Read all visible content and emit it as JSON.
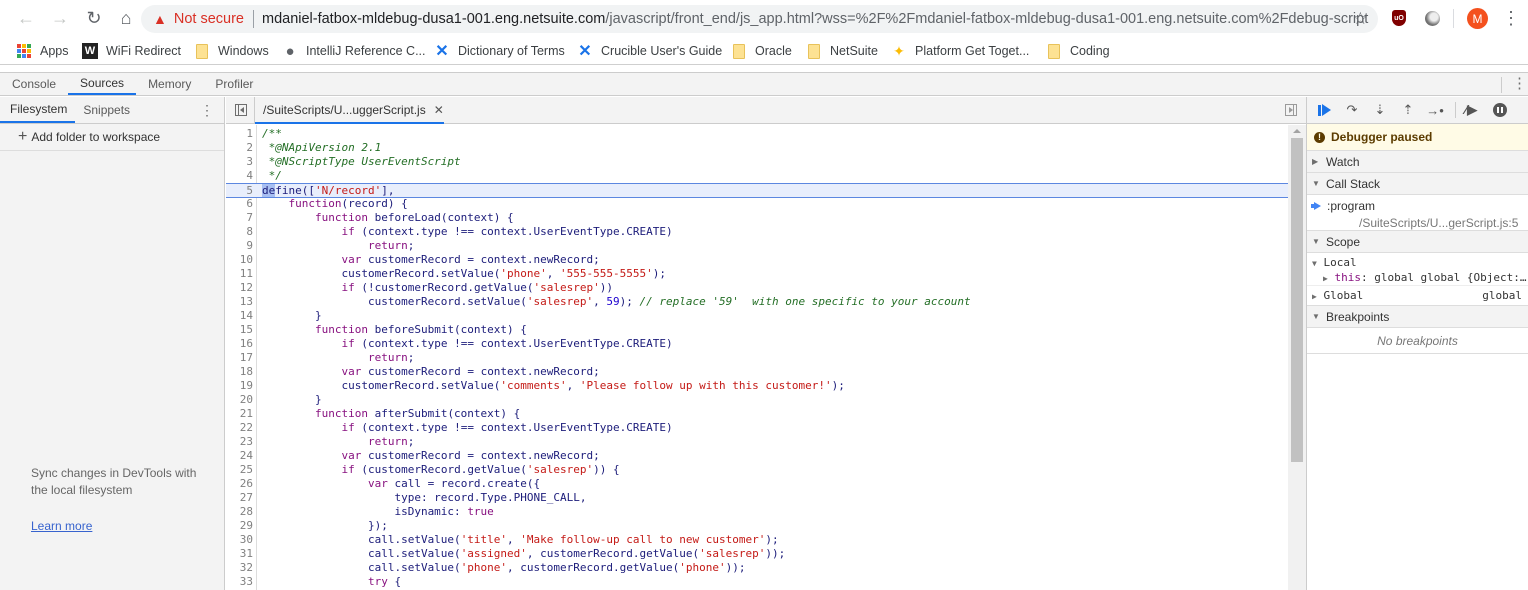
{
  "browser": {
    "security_label": "Not secure",
    "url_host": "mdaniel-fatbox-mldebug-dusa1-001.eng.netsuite.com",
    "url_path": "/javascript/front_end/js_app.html?wss=%2F%2Fmdaniel-fatbox-mldebug-dusa1-001.eng.netsuite.com%2Fdebug-script",
    "avatar_letter": "M",
    "ublock_label": "uO",
    "bookmarks": [
      {
        "label": "Apps",
        "icon": "apps-grid-icon"
      },
      {
        "label": "WiFi Redirect",
        "icon": "wifi-redirect-icon"
      },
      {
        "label": "Windows",
        "icon": "folder-icon"
      },
      {
        "label": "IntelliJ Reference C...",
        "icon": "globe-icon"
      },
      {
        "label": "Dictionary of Terms",
        "icon": "confluence-icon"
      },
      {
        "label": "Crucible User's Guide",
        "icon": "confluence-icon"
      },
      {
        "label": "Oracle",
        "icon": "folder-icon"
      },
      {
        "label": "NetSuite",
        "icon": "folder-icon"
      },
      {
        "label": "Platform Get Toget...",
        "icon": "pinwheel-icon"
      },
      {
        "label": "Coding",
        "icon": "folder-icon"
      }
    ]
  },
  "devtools": {
    "tabs": [
      {
        "label": "Console",
        "active": false
      },
      {
        "label": "Sources",
        "active": true
      },
      {
        "label": "Memory",
        "active": false
      },
      {
        "label": "Profiler",
        "active": false
      }
    ],
    "navigator": {
      "tabs": [
        {
          "label": "Filesystem",
          "active": true
        },
        {
          "label": "Snippets",
          "active": false
        }
      ],
      "add_folder_label": "Add folder to workspace",
      "sync_text": "Sync changes in DevTools with the local filesystem",
      "learn_more": "Learn more"
    },
    "editor": {
      "file_tab": "/SuiteScripts/U...uggerScript.js",
      "current_line": 5,
      "lines": [
        [
          {
            "t": "/**",
            "c": "comment"
          }
        ],
        [
          {
            "t": " *@NApiVersion 2.1",
            "c": "comment"
          }
        ],
        [
          {
            "t": " *@NScriptType UserEventScript",
            "c": "comment"
          }
        ],
        [
          {
            "t": " */",
            "c": "comment"
          }
        ],
        [
          {
            "t": "de",
            "c": "sel"
          },
          {
            "t": "fine",
            "c": "plainsel"
          },
          {
            "t": "([",
            "c": "plain"
          },
          {
            "t": "'N/record'",
            "c": "str"
          },
          {
            "t": "],",
            "c": "plain"
          }
        ],
        [
          {
            "t": "    ",
            "c": "plain"
          },
          {
            "t": "function",
            "c": "kw"
          },
          {
            "t": "(record) {",
            "c": "plain"
          }
        ],
        [
          {
            "t": "        ",
            "c": "plain"
          },
          {
            "t": "function",
            "c": "kw"
          },
          {
            "t": " beforeLoad(context) {",
            "c": "plain"
          }
        ],
        [
          {
            "t": "            ",
            "c": "plain"
          },
          {
            "t": "if",
            "c": "kw"
          },
          {
            "t": " (context.type !== context.UserEventType.CREATE)",
            "c": "plain"
          }
        ],
        [
          {
            "t": "                ",
            "c": "plain"
          },
          {
            "t": "return",
            "c": "kw"
          },
          {
            "t": ";",
            "c": "plain"
          }
        ],
        [
          {
            "t": "            ",
            "c": "plain"
          },
          {
            "t": "var",
            "c": "kw"
          },
          {
            "t": " customerRecord = context.newRecord;",
            "c": "plain"
          }
        ],
        [
          {
            "t": "            customerRecord.setValue(",
            "c": "plain"
          },
          {
            "t": "'phone'",
            "c": "str"
          },
          {
            "t": ", ",
            "c": "plain"
          },
          {
            "t": "'555-555-5555'",
            "c": "str"
          },
          {
            "t": ");",
            "c": "plain"
          }
        ],
        [
          {
            "t": "            ",
            "c": "plain"
          },
          {
            "t": "if",
            "c": "kw"
          },
          {
            "t": " (!customerRecord.getValue(",
            "c": "plain"
          },
          {
            "t": "'salesrep'",
            "c": "str"
          },
          {
            "t": "))",
            "c": "plain"
          }
        ],
        [
          {
            "t": "                customerRecord.setValue(",
            "c": "plain"
          },
          {
            "t": "'salesrep'",
            "c": "str"
          },
          {
            "t": ", ",
            "c": "plain"
          },
          {
            "t": "59",
            "c": "num"
          },
          {
            "t": "); ",
            "c": "plain"
          },
          {
            "t": "// replace '59'  with one specific to your account",
            "c": "comment"
          }
        ],
        [
          {
            "t": "        }",
            "c": "plain"
          }
        ],
        [
          {
            "t": "        ",
            "c": "plain"
          },
          {
            "t": "function",
            "c": "kw"
          },
          {
            "t": " beforeSubmit(context) {",
            "c": "plain"
          }
        ],
        [
          {
            "t": "            ",
            "c": "plain"
          },
          {
            "t": "if",
            "c": "kw"
          },
          {
            "t": " (context.type !== context.UserEventType.CREATE)",
            "c": "plain"
          }
        ],
        [
          {
            "t": "                ",
            "c": "plain"
          },
          {
            "t": "return",
            "c": "kw"
          },
          {
            "t": ";",
            "c": "plain"
          }
        ],
        [
          {
            "t": "            ",
            "c": "plain"
          },
          {
            "t": "var",
            "c": "kw"
          },
          {
            "t": " customerRecord = context.newRecord;",
            "c": "plain"
          }
        ],
        [
          {
            "t": "            customerRecord.setValue(",
            "c": "plain"
          },
          {
            "t": "'comments'",
            "c": "str"
          },
          {
            "t": ", ",
            "c": "plain"
          },
          {
            "t": "'Please follow up with this customer!'",
            "c": "str"
          },
          {
            "t": ");",
            "c": "plain"
          }
        ],
        [
          {
            "t": "        }",
            "c": "plain"
          }
        ],
        [
          {
            "t": "        ",
            "c": "plain"
          },
          {
            "t": "function",
            "c": "kw"
          },
          {
            "t": " afterSubmit(context) {",
            "c": "plain"
          }
        ],
        [
          {
            "t": "            ",
            "c": "plain"
          },
          {
            "t": "if",
            "c": "kw"
          },
          {
            "t": " (context.type !== context.UserEventType.CREATE)",
            "c": "plain"
          }
        ],
        [
          {
            "t": "                ",
            "c": "plain"
          },
          {
            "t": "return",
            "c": "kw"
          },
          {
            "t": ";",
            "c": "plain"
          }
        ],
        [
          {
            "t": "            ",
            "c": "plain"
          },
          {
            "t": "var",
            "c": "kw"
          },
          {
            "t": " customerRecord = context.newRecord;",
            "c": "plain"
          }
        ],
        [
          {
            "t": "            ",
            "c": "plain"
          },
          {
            "t": "if",
            "c": "kw"
          },
          {
            "t": " (customerRecord.getValue(",
            "c": "plain"
          },
          {
            "t": "'salesrep'",
            "c": "str"
          },
          {
            "t": ")) {",
            "c": "plain"
          }
        ],
        [
          {
            "t": "                ",
            "c": "plain"
          },
          {
            "t": "var",
            "c": "kw"
          },
          {
            "t": " call = record.create({",
            "c": "plain"
          }
        ],
        [
          {
            "t": "                    type: record.Type.PHONE_CALL,",
            "c": "plain"
          }
        ],
        [
          {
            "t": "                    isDynamic: ",
            "c": "plain"
          },
          {
            "t": "true",
            "c": "kw"
          }
        ],
        [
          {
            "t": "                });",
            "c": "plain"
          }
        ],
        [
          {
            "t": "                call.setValue(",
            "c": "plain"
          },
          {
            "t": "'title'",
            "c": "str"
          },
          {
            "t": ", ",
            "c": "plain"
          },
          {
            "t": "'Make follow-up call to new customer'",
            "c": "str"
          },
          {
            "t": ");",
            "c": "plain"
          }
        ],
        [
          {
            "t": "                call.setValue(",
            "c": "plain"
          },
          {
            "t": "'assigned'",
            "c": "str"
          },
          {
            "t": ", customerRecord.getValue(",
            "c": "plain"
          },
          {
            "t": "'salesrep'",
            "c": "str"
          },
          {
            "t": "));",
            "c": "plain"
          }
        ],
        [
          {
            "t": "                call.setValue(",
            "c": "plain"
          },
          {
            "t": "'phone'",
            "c": "str"
          },
          {
            "t": ", customerRecord.getValue(",
            "c": "plain"
          },
          {
            "t": "'phone'",
            "c": "str"
          },
          {
            "t": "));",
            "c": "plain"
          }
        ],
        [
          {
            "t": "                ",
            "c": "plain"
          },
          {
            "t": "try",
            "c": "kw"
          },
          {
            "t": " {",
            "c": "plain"
          }
        ]
      ]
    },
    "debugger": {
      "paused_label": "Debugger paused",
      "panes": {
        "watch": "Watch",
        "call_stack": "Call Stack",
        "scope": "Scope",
        "breakpoints": "Breakpoints"
      },
      "call_frame": {
        "name": ":program",
        "location": "/SuiteScripts/U...gerScript.js:5"
      },
      "scope": {
        "local_label": "Local",
        "this_key": "this",
        "this_value": "global global {Object:…",
        "global_label": "Global",
        "global_value": "global"
      },
      "no_breakpoints": "No breakpoints"
    }
  }
}
